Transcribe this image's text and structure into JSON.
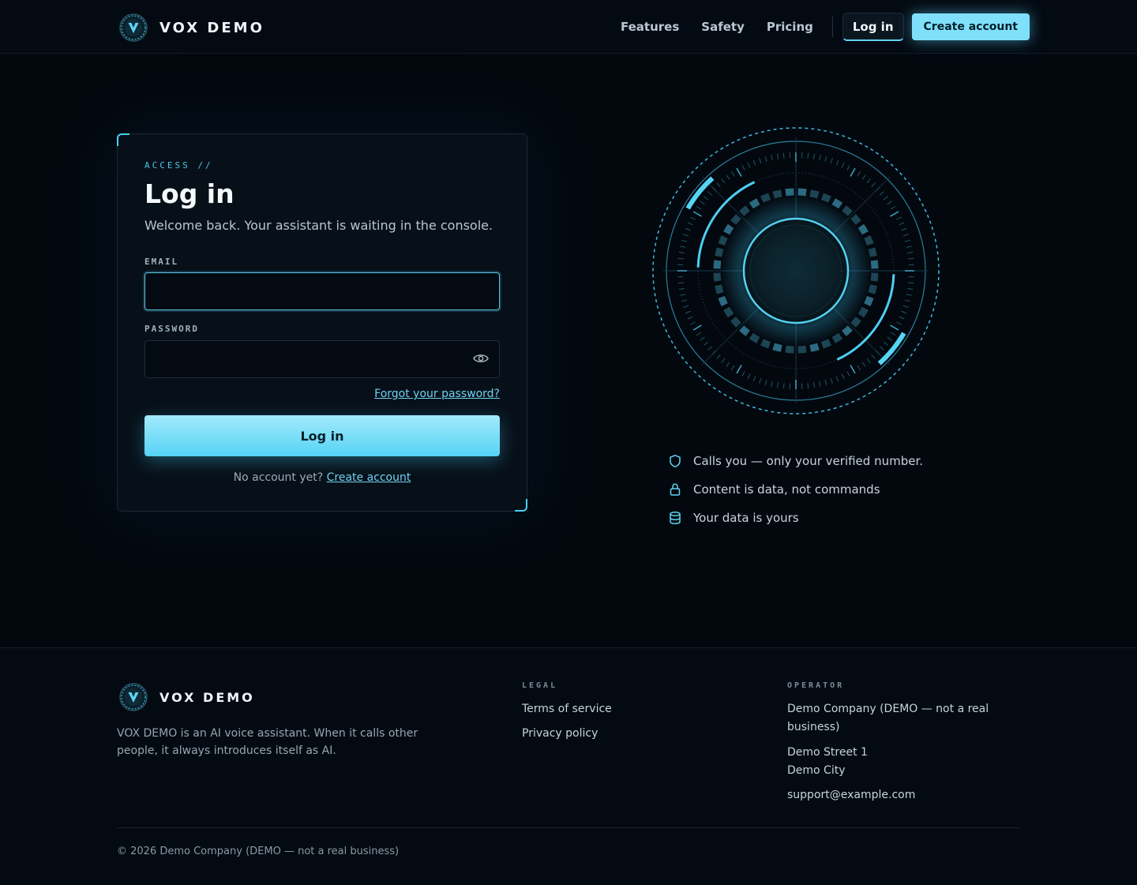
{
  "header": {
    "brand": "VOX DEMO",
    "nav": [
      "Features",
      "Safety",
      "Pricing"
    ],
    "login": "Log in",
    "create": "Create account"
  },
  "card": {
    "eyebrow": "ACCESS //",
    "title": "Log in",
    "subtitle": "Welcome back. Your assistant is waiting in the console.",
    "email_label": "EMAIL",
    "password_label": "PASSWORD",
    "forgot": "Forgot your password?",
    "submit": "Log in",
    "no_account": "No account yet?",
    "create_link": "Create account"
  },
  "features": [
    {
      "icon": "shield-icon",
      "text": "Calls you — only your verified number."
    },
    {
      "icon": "lock-icon",
      "text": "Content is data, not commands"
    },
    {
      "icon": "database-icon",
      "text": "Your data is yours"
    }
  ],
  "footer": {
    "brand": "VOX DEMO",
    "description": "VOX DEMO is an AI voice assistant. When it calls other people, it always introduces itself as AI.",
    "legal_title": "LEGAL",
    "legal_links": [
      "Terms of service",
      "Privacy policy"
    ],
    "operator_title": "OPERATOR",
    "operator_name": "Demo Company (DEMO — not a real business)",
    "street": "Demo Street 1",
    "city": "Demo City",
    "email": "support@example.com",
    "copyright": "© 2026 Demo Company (DEMO — not a real business)"
  },
  "colors": {
    "accent": "#5fd4f2",
    "background": "#03080f"
  }
}
